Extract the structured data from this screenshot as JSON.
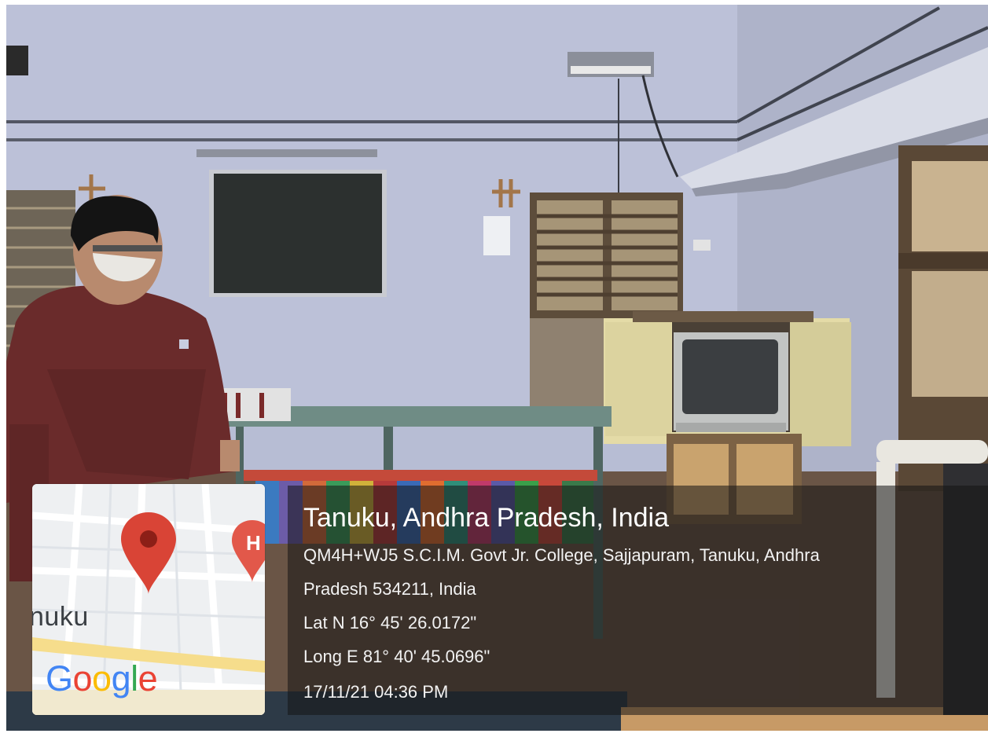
{
  "scene": {
    "description_colors": {
      "wall": "#b9bfd6",
      "floor": "#6b5443",
      "shirt": "#6a2b2b",
      "blackboard": "#2b2f2e",
      "table": "#6f8b84"
    }
  },
  "map": {
    "place_label": "nuku",
    "logo_text": "Google",
    "pin_color": "#d94436",
    "hospital_marker": "H"
  },
  "geotag": {
    "title": "Tanuku, Andhra Pradesh, India",
    "address_line1": "QM4H+WJ5 S.C.I.M. Govt Jr. College, Sajjapuram, Tanuku, Andhra",
    "address_line2": "Pradesh 534211, India",
    "latitude": "Lat N 16° 45' 26.0172\"",
    "longitude": "Long E 81° 40' 45.0696\"",
    "datetime": "17/11/21 04:36 PM"
  }
}
